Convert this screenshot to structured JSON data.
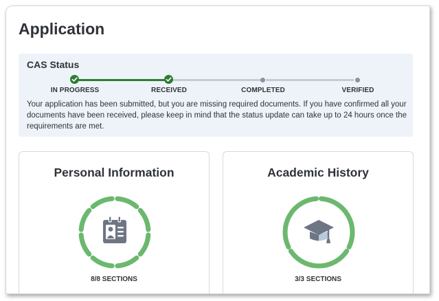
{
  "page": {
    "title": "Application"
  },
  "cas_status": {
    "title": "CAS Status",
    "steps": [
      {
        "label": "IN PROGRESS",
        "state": "complete"
      },
      {
        "label": "RECEIVED",
        "state": "complete"
      },
      {
        "label": "COMPLETED",
        "state": "pending"
      },
      {
        "label": "VERIFIED",
        "state": "pending"
      }
    ],
    "message": "Your application has been submitted, but you are missing required documents. If you have confirmed all your documents have been received, please keep in mind that the status update can take up to 24 hours once the requirements are met."
  },
  "cards": [
    {
      "title": "Personal Information",
      "icon": "id-badge-icon",
      "sections_label": "8/8 SECTIONS",
      "completed": 8,
      "total": 8
    },
    {
      "title": "Academic History",
      "icon": "graduation-cap-icon",
      "sections_label": "3/3 SECTIONS",
      "completed": 3,
      "total": 3
    }
  ],
  "colors": {
    "accent_green": "#2e7d32",
    "ring_green": "#6bb86e",
    "panel_bg": "#eef3f9",
    "icon_gray": "#6e7684"
  }
}
